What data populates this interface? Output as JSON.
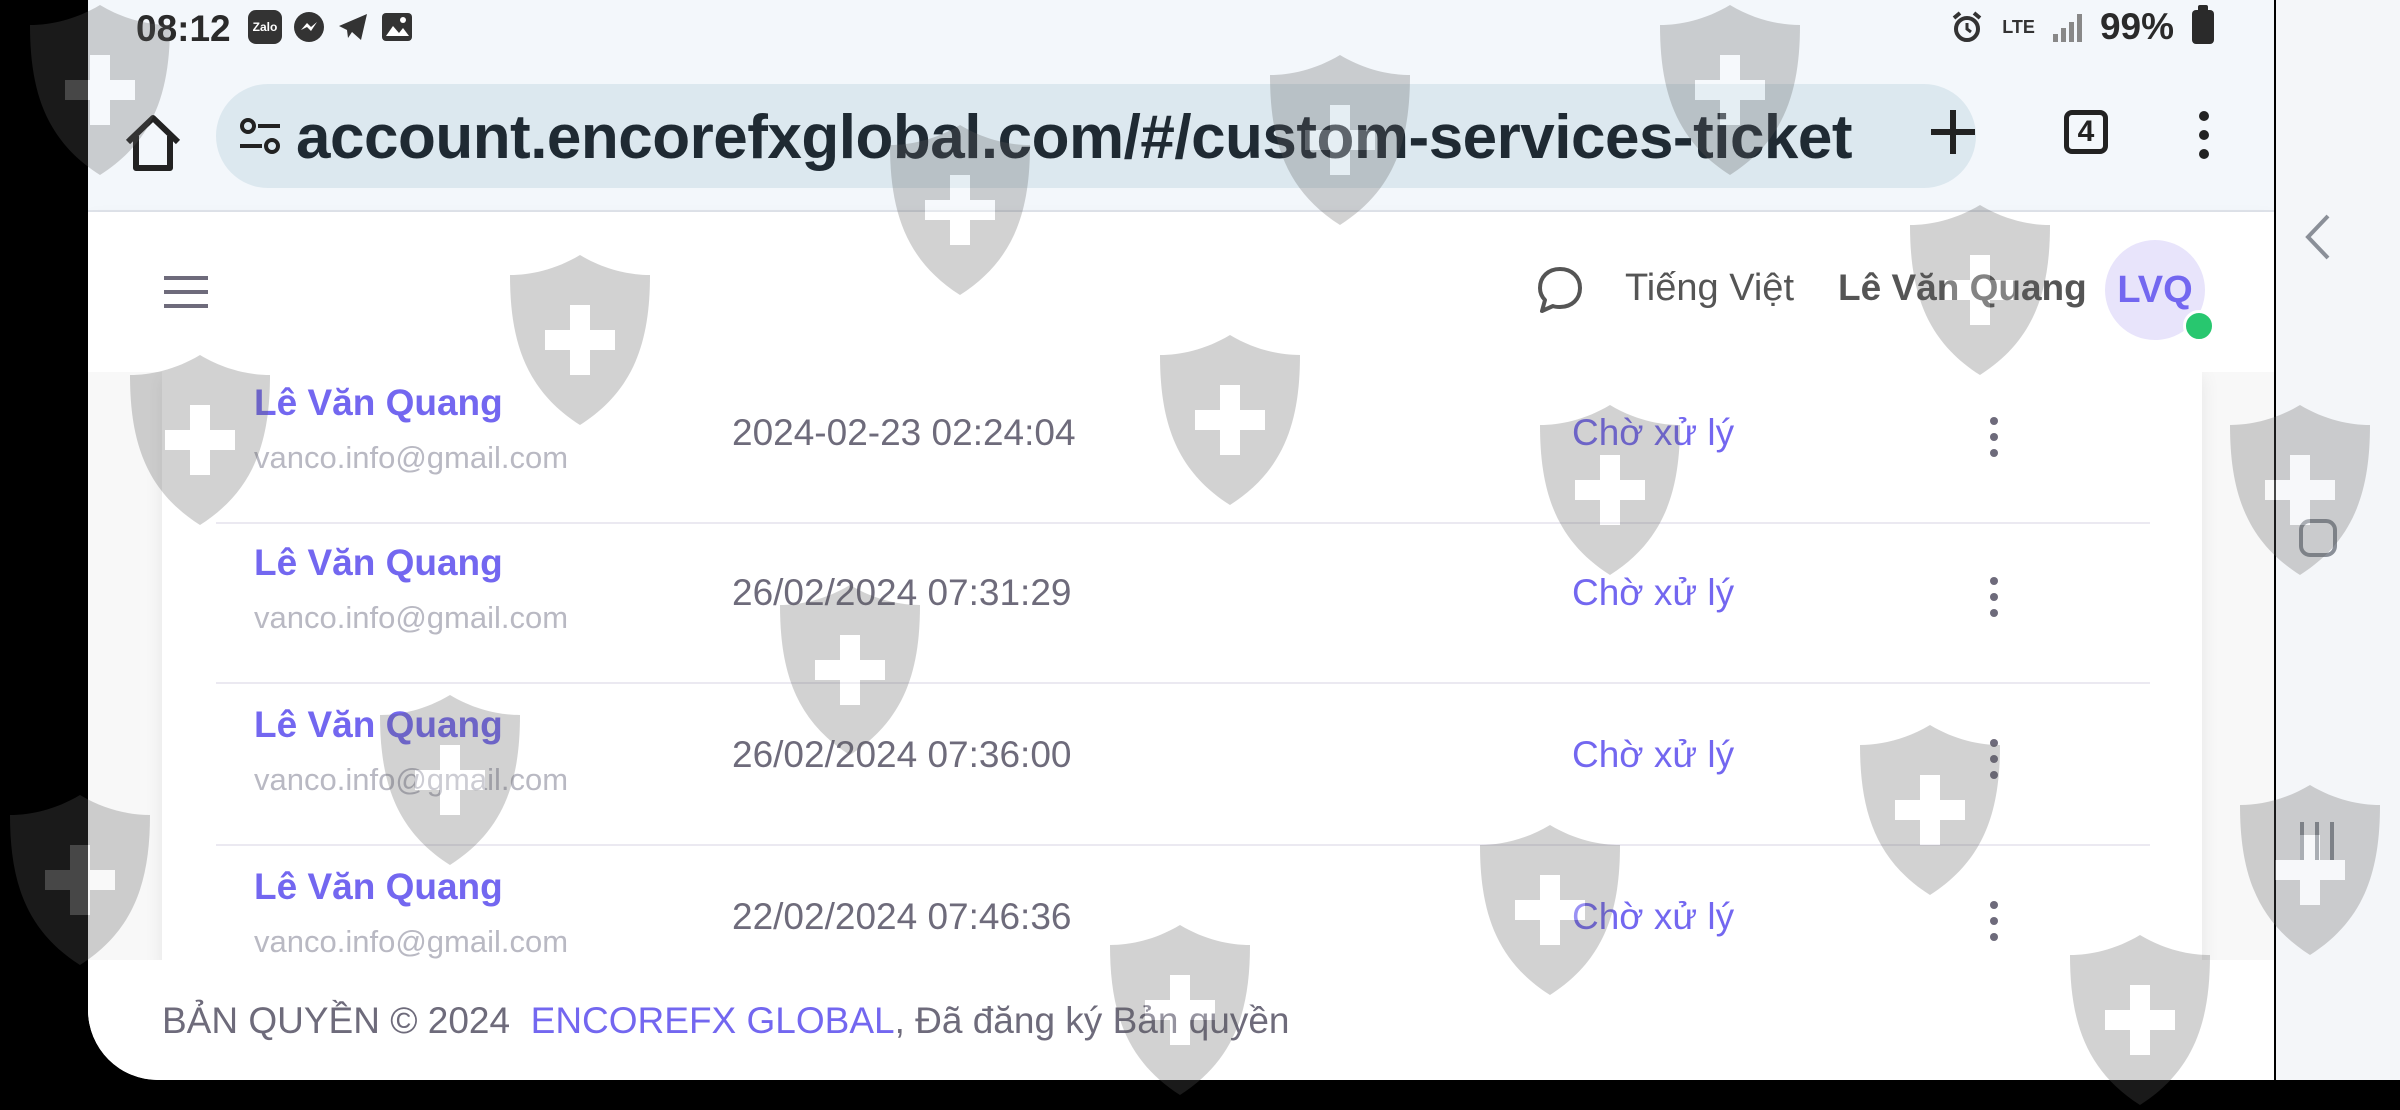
{
  "status_bar": {
    "time": "08:12",
    "apps": [
      "Zalo",
      "Messenger",
      "Telegram",
      "Gallery"
    ],
    "network": "LTE",
    "battery": "99%"
  },
  "browser": {
    "url": "account.encorefxglobal.com/#/custom-services-ticket",
    "tab_count": "4"
  },
  "header": {
    "language": "Tiếng Việt",
    "user_name": "Lê Văn Quang",
    "avatar_initials": "LVQ"
  },
  "tickets": [
    {
      "name": "Lê Văn Quang",
      "email": "vanco.info@gmail.com",
      "date": "2024-02-23 02:24:04",
      "status": "Chờ xử lý"
    },
    {
      "name": "Lê Văn Quang",
      "email": "vanco.info@gmail.com",
      "date": "26/02/2024 07:31:29",
      "status": "Chờ xử lý"
    },
    {
      "name": "Lê Văn Quang",
      "email": "vanco.info@gmail.com",
      "date": "26/02/2024 07:36:00",
      "status": "Chờ xử lý"
    },
    {
      "name": "Lê Văn Quang",
      "email": "vanco.info@gmail.com",
      "date": "22/02/2024 07:46:36",
      "status": "Chờ xử lý"
    }
  ],
  "footer": {
    "prefix": "BẢN QUYỀN © 2024",
    "brand": "ENCOREFX GLOBAL",
    "suffix": ", Đã đăng ký Bản quyền"
  },
  "colors": {
    "primary": "#7367f0",
    "online": "#28c76f",
    "text": "#6e6b7b"
  }
}
